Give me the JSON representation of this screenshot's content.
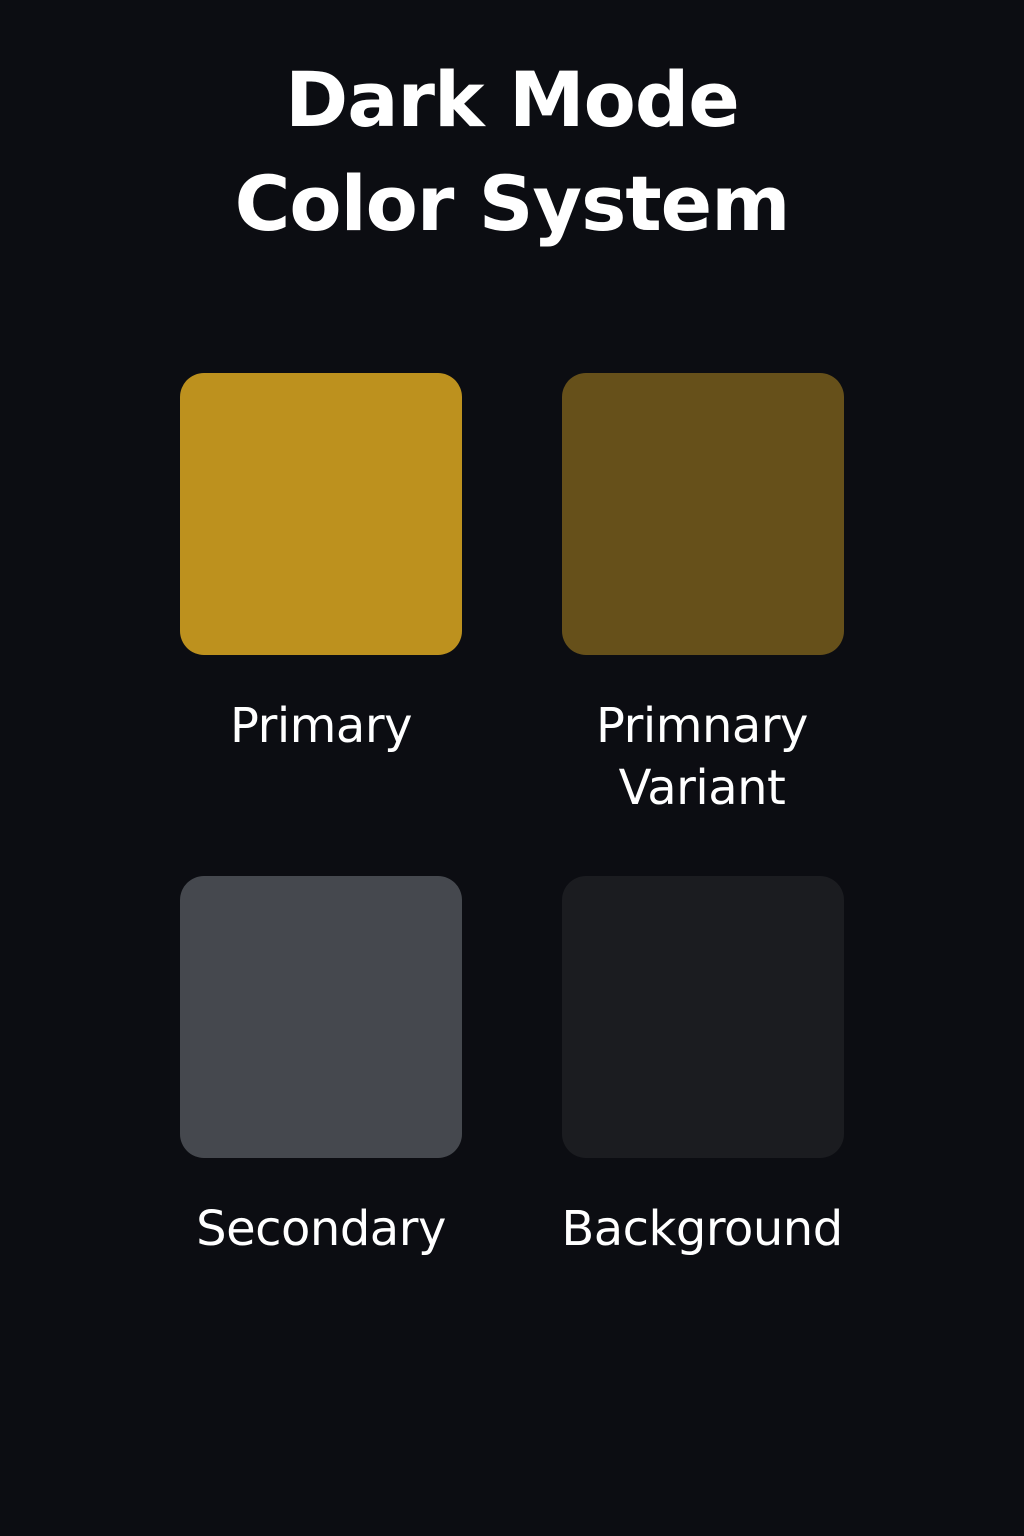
{
  "title": {
    "line1": "Dark Mode",
    "line2": "Color System"
  },
  "swatches": [
    {
      "label_line1": "Primary",
      "label_line2": "",
      "color": "#bd911e"
    },
    {
      "label_line1": "Primnary",
      "label_line2": "Variant",
      "color": "#66501a"
    },
    {
      "label_line1": "Secondary",
      "label_line2": "",
      "color": "#45484e"
    },
    {
      "label_line1": "Background",
      "label_line2": "",
      "color": "#1b1c20"
    }
  ],
  "colors": {
    "page_background": "#0c0d12",
    "text": "#ffffff"
  }
}
